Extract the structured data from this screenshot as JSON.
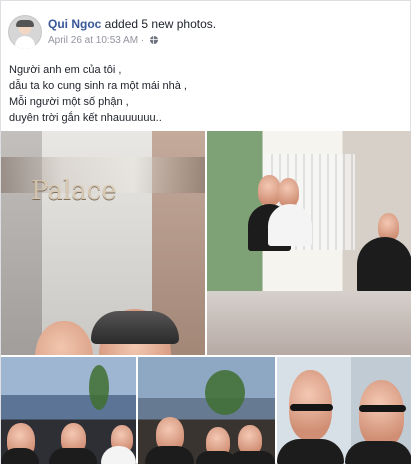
{
  "post": {
    "author_name": "Qui Ngoc",
    "action_text": " added 5 new photos.",
    "timestamp": "April 26 at 10:53 AM",
    "separator": " · ",
    "privacy_icon": "globe-icon"
  },
  "caption": {
    "lines": [
      "Người anh em của tôi ,",
      "dẫu ta ko cung sinh ra một mái nhà ,",
      "Mỗi người một số phận ,",
      "duyên trời gắn kết nhauuuuuu.."
    ]
  },
  "photos": [
    {
      "label": "photo-1",
      "sign_text": "Palace"
    },
    {
      "label": "photo-2"
    },
    {
      "label": "photo-3"
    },
    {
      "label": "photo-4"
    },
    {
      "label": "photo-5"
    }
  ],
  "colors": {
    "link": "#385898",
    "text": "#1d2129",
    "meta": "#90949c",
    "border": "#dddfe2"
  }
}
